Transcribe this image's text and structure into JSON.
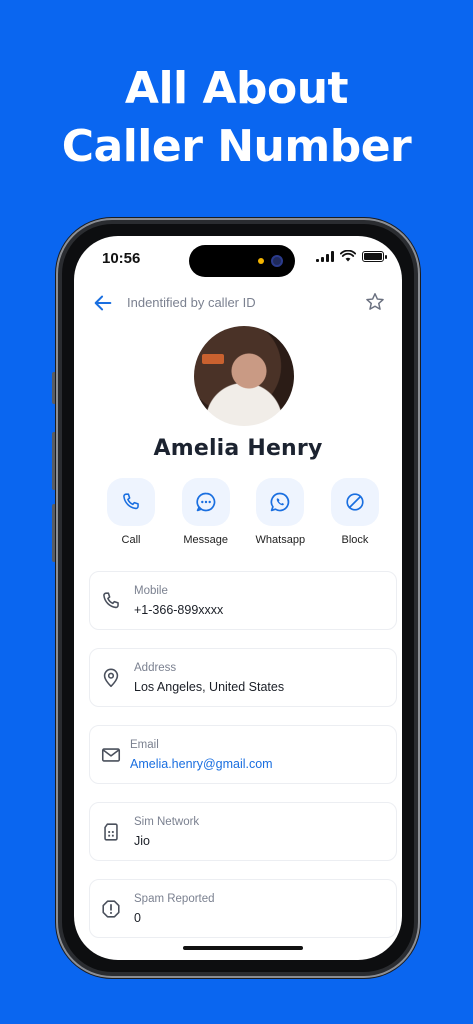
{
  "headline": {
    "line1": "All About",
    "line2": "Caller Number"
  },
  "status_bar": {
    "time": "10:56"
  },
  "topbar": {
    "title": "Indentified by caller ID",
    "back_icon": "arrow-left-icon",
    "favorite_icon": "star-icon"
  },
  "contact": {
    "name": "Amelia Henry"
  },
  "actions": [
    {
      "label": "Call",
      "icon": "phone-icon"
    },
    {
      "label": "Message",
      "icon": "message-bubble-icon"
    },
    {
      "label": "Whatsapp",
      "icon": "whatsapp-icon"
    },
    {
      "label": "Block",
      "icon": "block-icon"
    }
  ],
  "details": [
    {
      "label": "Mobile",
      "value": "+1-366-899xxxx",
      "icon": "phone-icon"
    },
    {
      "label": "Address",
      "value": "Los Angeles, United States",
      "icon": "location-pin-icon"
    },
    {
      "label": "Email",
      "value": "Amelia.henry@gmail.com",
      "icon": "mail-icon"
    },
    {
      "label": "Sim Network",
      "value": "Jio",
      "icon": "sim-card-icon"
    },
    {
      "label": "Spam Reported",
      "value": "0",
      "icon": "alert-octagon-icon"
    }
  ],
  "colors": {
    "background": "#0a66f0",
    "accent": "#1a6fe0",
    "action_bg": "#eef4fe"
  }
}
